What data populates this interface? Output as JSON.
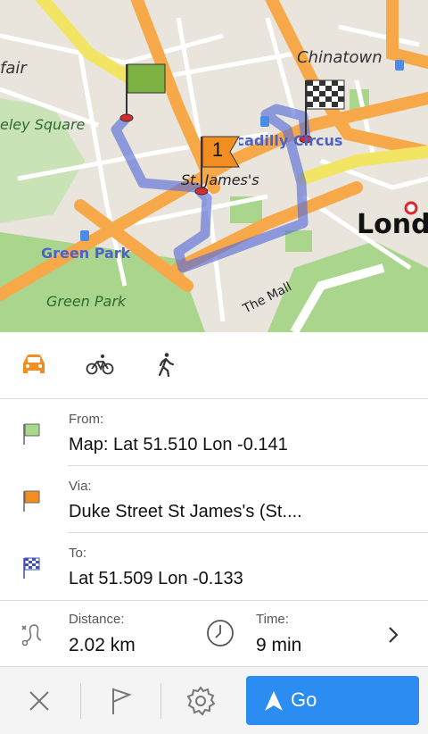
{
  "map": {
    "labels": {
      "mayfair": "fair",
      "berkeley_square": "eley Square",
      "chinatown": "Chinatown",
      "piccadilly_circus": "Piccadilly Circus",
      "st_james": "St. James's",
      "london": "Lond",
      "green_park_station": "Green Park",
      "green_park": "Green Park",
      "the_mall": "The Mall"
    },
    "via_marker_number": "1"
  },
  "modes": [
    {
      "name": "car",
      "active": true
    },
    {
      "name": "bicycle",
      "active": false
    },
    {
      "name": "pedestrian",
      "active": false
    }
  ],
  "route": {
    "from": {
      "label": "From:",
      "value": "Map: Lat 51.510 Lon -0.141"
    },
    "via": {
      "label": "Via:",
      "value": "Duke Street St James's (St...."
    },
    "to": {
      "label": "To:",
      "value": "Lat 51.509 Lon -0.133"
    }
  },
  "stats": {
    "distance_label": "Distance:",
    "distance_value": "2.02 km",
    "time_label": "Time:",
    "time_value": "9 min"
  },
  "toolbar": {
    "go_label": "Go"
  },
  "colors": {
    "accent": "#2b8cf1",
    "car_active": "#f28d21",
    "from_flag": "#8fcb5d",
    "via_flag": "#f28d21",
    "route": "#5a6fd8"
  }
}
